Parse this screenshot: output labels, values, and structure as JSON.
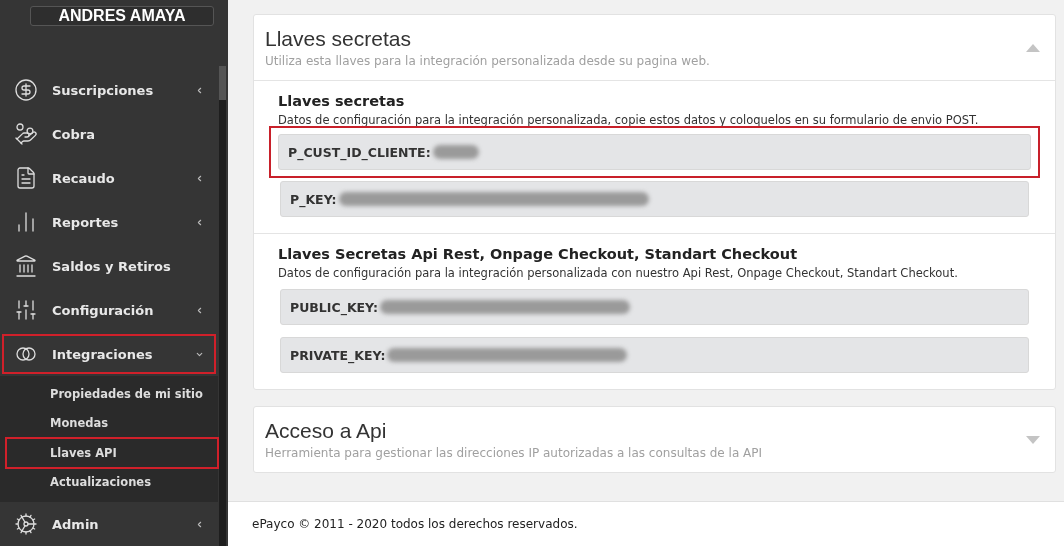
{
  "sidebar": {
    "user_name": "ANDRES AMAYA",
    "items": [
      {
        "label": "Suscripciones",
        "kind": "group",
        "expanded": false,
        "highlighted": false
      },
      {
        "label": "Cobra",
        "kind": "link",
        "highlighted": false
      },
      {
        "label": "Recaudo",
        "kind": "group",
        "expanded": false,
        "highlighted": false
      },
      {
        "label": "Reportes",
        "kind": "group",
        "expanded": false,
        "highlighted": false
      },
      {
        "label": "Saldos y Retiros",
        "kind": "link",
        "highlighted": false
      },
      {
        "label": "Configuración",
        "kind": "group",
        "expanded": false,
        "highlighted": false
      },
      {
        "label": "Integraciones",
        "kind": "group",
        "expanded": true,
        "highlighted": true,
        "children": [
          {
            "label": "Propiedades de mi sitio",
            "highlighted": false
          },
          {
            "label": "Monedas",
            "highlighted": false
          },
          {
            "label": "Llaves API",
            "highlighted": true
          },
          {
            "label": "Actualizaciones",
            "highlighted": false
          }
        ]
      },
      {
        "label": "Admin",
        "kind": "group",
        "expanded": false,
        "highlighted": false
      }
    ]
  },
  "cards": [
    {
      "title": "Llaves secretas",
      "subtitle": "Utiliza esta llaves para la integración personalizada desde su pagina web.",
      "expanded": true,
      "sections": [
        {
          "heading": "Llaves secretas",
          "description": "Datos de configuración para la integración personalizada, copie estos datos y coloquelos en su formulario de envio POST.",
          "fields": [
            {
              "label": "P_CUST_ID_CLIENTE:",
              "highlighted": true
            },
            {
              "label": "P_KEY:",
              "highlighted": false
            }
          ]
        },
        {
          "heading": "Llaves Secretas Api Rest, Onpage Checkout, Standart Checkout",
          "description": "Datos de configuración para la integración personalizada con nuestro Api Rest, Onpage Checkout, Standart Checkout.",
          "fields": [
            {
              "label": "PUBLIC_KEY:",
              "highlighted": false
            },
            {
              "label": "PRIVATE_KEY:",
              "highlighted": false
            }
          ]
        }
      ]
    },
    {
      "title": "Acceso a Api",
      "subtitle": "Herramienta para gestionar las direcciones IP autorizadas a las consultas de la API",
      "expanded": false
    }
  ],
  "footer": "ePayco © 2011 - 2020 todos los derechos reservados."
}
